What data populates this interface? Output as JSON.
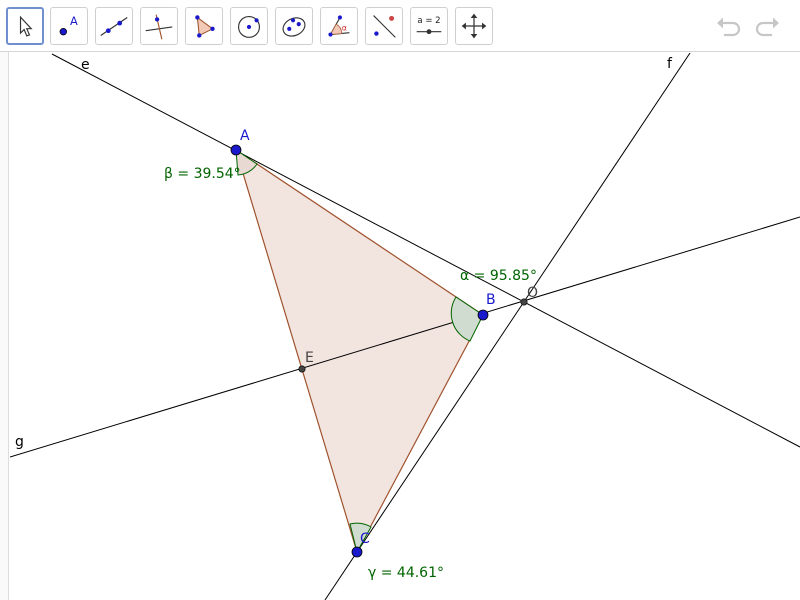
{
  "toolbar": {
    "tools": [
      {
        "name": "move-tool",
        "selected": true
      },
      {
        "name": "point-tool",
        "selected": false,
        "glyph": "A"
      },
      {
        "name": "line-tool",
        "selected": false
      },
      {
        "name": "perpendicular-line-tool",
        "selected": false
      },
      {
        "name": "polygon-tool",
        "selected": false
      },
      {
        "name": "circle-center-point-tool",
        "selected": false
      },
      {
        "name": "ellipse-tool",
        "selected": false
      },
      {
        "name": "angle-tool",
        "selected": false,
        "glyph": "α"
      },
      {
        "name": "reflect-tool",
        "selected": false
      },
      {
        "name": "slider-tool",
        "selected": false,
        "glyph": "a = 2"
      },
      {
        "name": "move-graphics-view-tool",
        "selected": false
      }
    ],
    "undo_icon": "undo-icon",
    "redo_icon": "redo-icon"
  },
  "canvas": {
    "points": {
      "A": {
        "label": "A"
      },
      "B": {
        "label": "B"
      },
      "C": {
        "label": "C"
      },
      "E": {
        "label": "E"
      },
      "O": {
        "label": "O"
      }
    },
    "lines": {
      "e": {
        "label": "e"
      },
      "f": {
        "label": "f"
      },
      "g": {
        "label": "g"
      }
    },
    "angles": {
      "alpha": {
        "label": "α = 95.85°"
      },
      "beta": {
        "label": "β = 39.54°"
      },
      "gamma": {
        "label": "γ = 44.61°"
      }
    },
    "colors": {
      "point": "#1a1acc",
      "triangle_fill": "#f2e4df",
      "triangle_edge": "#a0522d",
      "angle": "#006400",
      "angle_fill": "#cfdccf",
      "line": "#000000"
    }
  }
}
